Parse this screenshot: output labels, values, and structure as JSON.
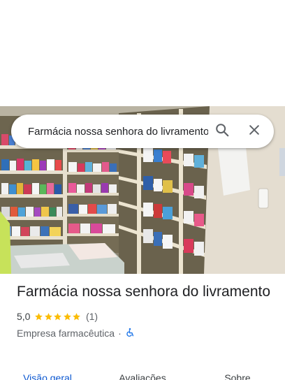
{
  "search": {
    "value": "Farmácia nossa senhora do livramento"
  },
  "place": {
    "name": "Farmácia nossa senhora do livramento",
    "rating": "5,0",
    "rating_stars": 5,
    "review_count": "(1)",
    "category": "Empresa farmacêutica",
    "separator": "·"
  },
  "tabs": [
    {
      "label": "Visão geral",
      "active": true
    },
    {
      "label": "Avaliações",
      "active": false
    },
    {
      "label": "Sobre",
      "active": false
    }
  ],
  "icons": {
    "search": "search-icon",
    "close": "close-icon",
    "accessibility": "wheelchair-icon",
    "star": "star-icon"
  },
  "colors": {
    "star": "#fbbc04",
    "accent": "#0b57d0",
    "accessibility": "#1a73e8"
  }
}
